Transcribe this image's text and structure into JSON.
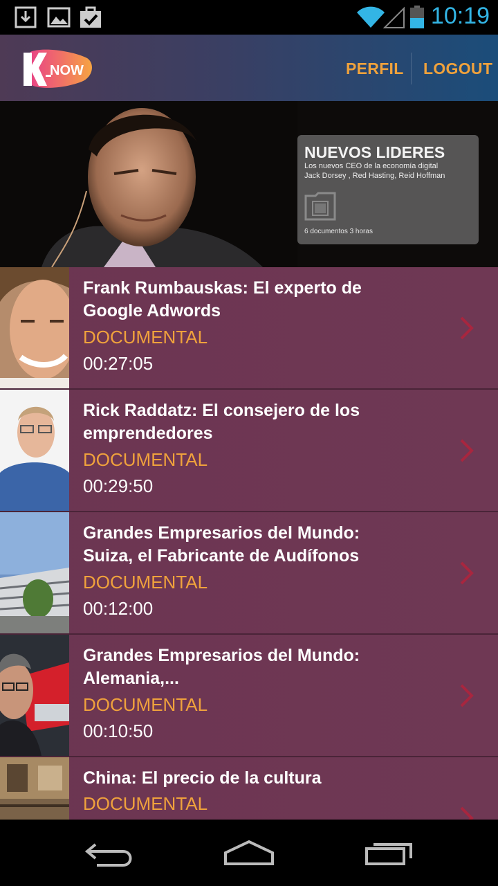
{
  "status_bar": {
    "time": "10:19",
    "icons": [
      "download-icon",
      "image-icon",
      "task-icon",
      "wifi-icon",
      "signal-icon",
      "battery-icon"
    ],
    "time_color": "#33b5e5"
  },
  "header": {
    "logo_text": "K_NOW",
    "nav": {
      "profile": "PERFIL",
      "logout": "LOGOUT"
    },
    "accent_color": "#f0a23c"
  },
  "hero": {
    "card_title": "NUEVOS LIDERES",
    "card_subtitle_1": "Los nuevos CEO de la economía digital",
    "card_subtitle_2": "Jack Dorsey , Red Hasting, Reid Hoffman",
    "card_meta": "6 documentos 3 horas"
  },
  "list": {
    "items": [
      {
        "title": "Frank Rumbauskas: El experto de Google Adwords",
        "category": "DOCUMENTAL",
        "duration": "00:27:05"
      },
      {
        "title": "Rick Raddatz: El consejero de los emprendedores",
        "category": "DOCUMENTAL",
        "duration": "00:29:50"
      },
      {
        "title": "Grandes Empresarios del Mundo: Suiza, el Fabricante de Audífonos",
        "category": "DOCUMENTAL",
        "duration": "00:12:00"
      },
      {
        "title": "Grandes Empresarios del Mundo: Alemania,...",
        "category": "DOCUMENTAL",
        "duration": "00:10:50"
      },
      {
        "title": "China: El precio de la cultura",
        "category": "DOCUMENTAL",
        "duration": ""
      }
    ]
  },
  "nav_bar": {
    "buttons": [
      "back-icon",
      "home-icon",
      "recent-apps-icon"
    ]
  }
}
